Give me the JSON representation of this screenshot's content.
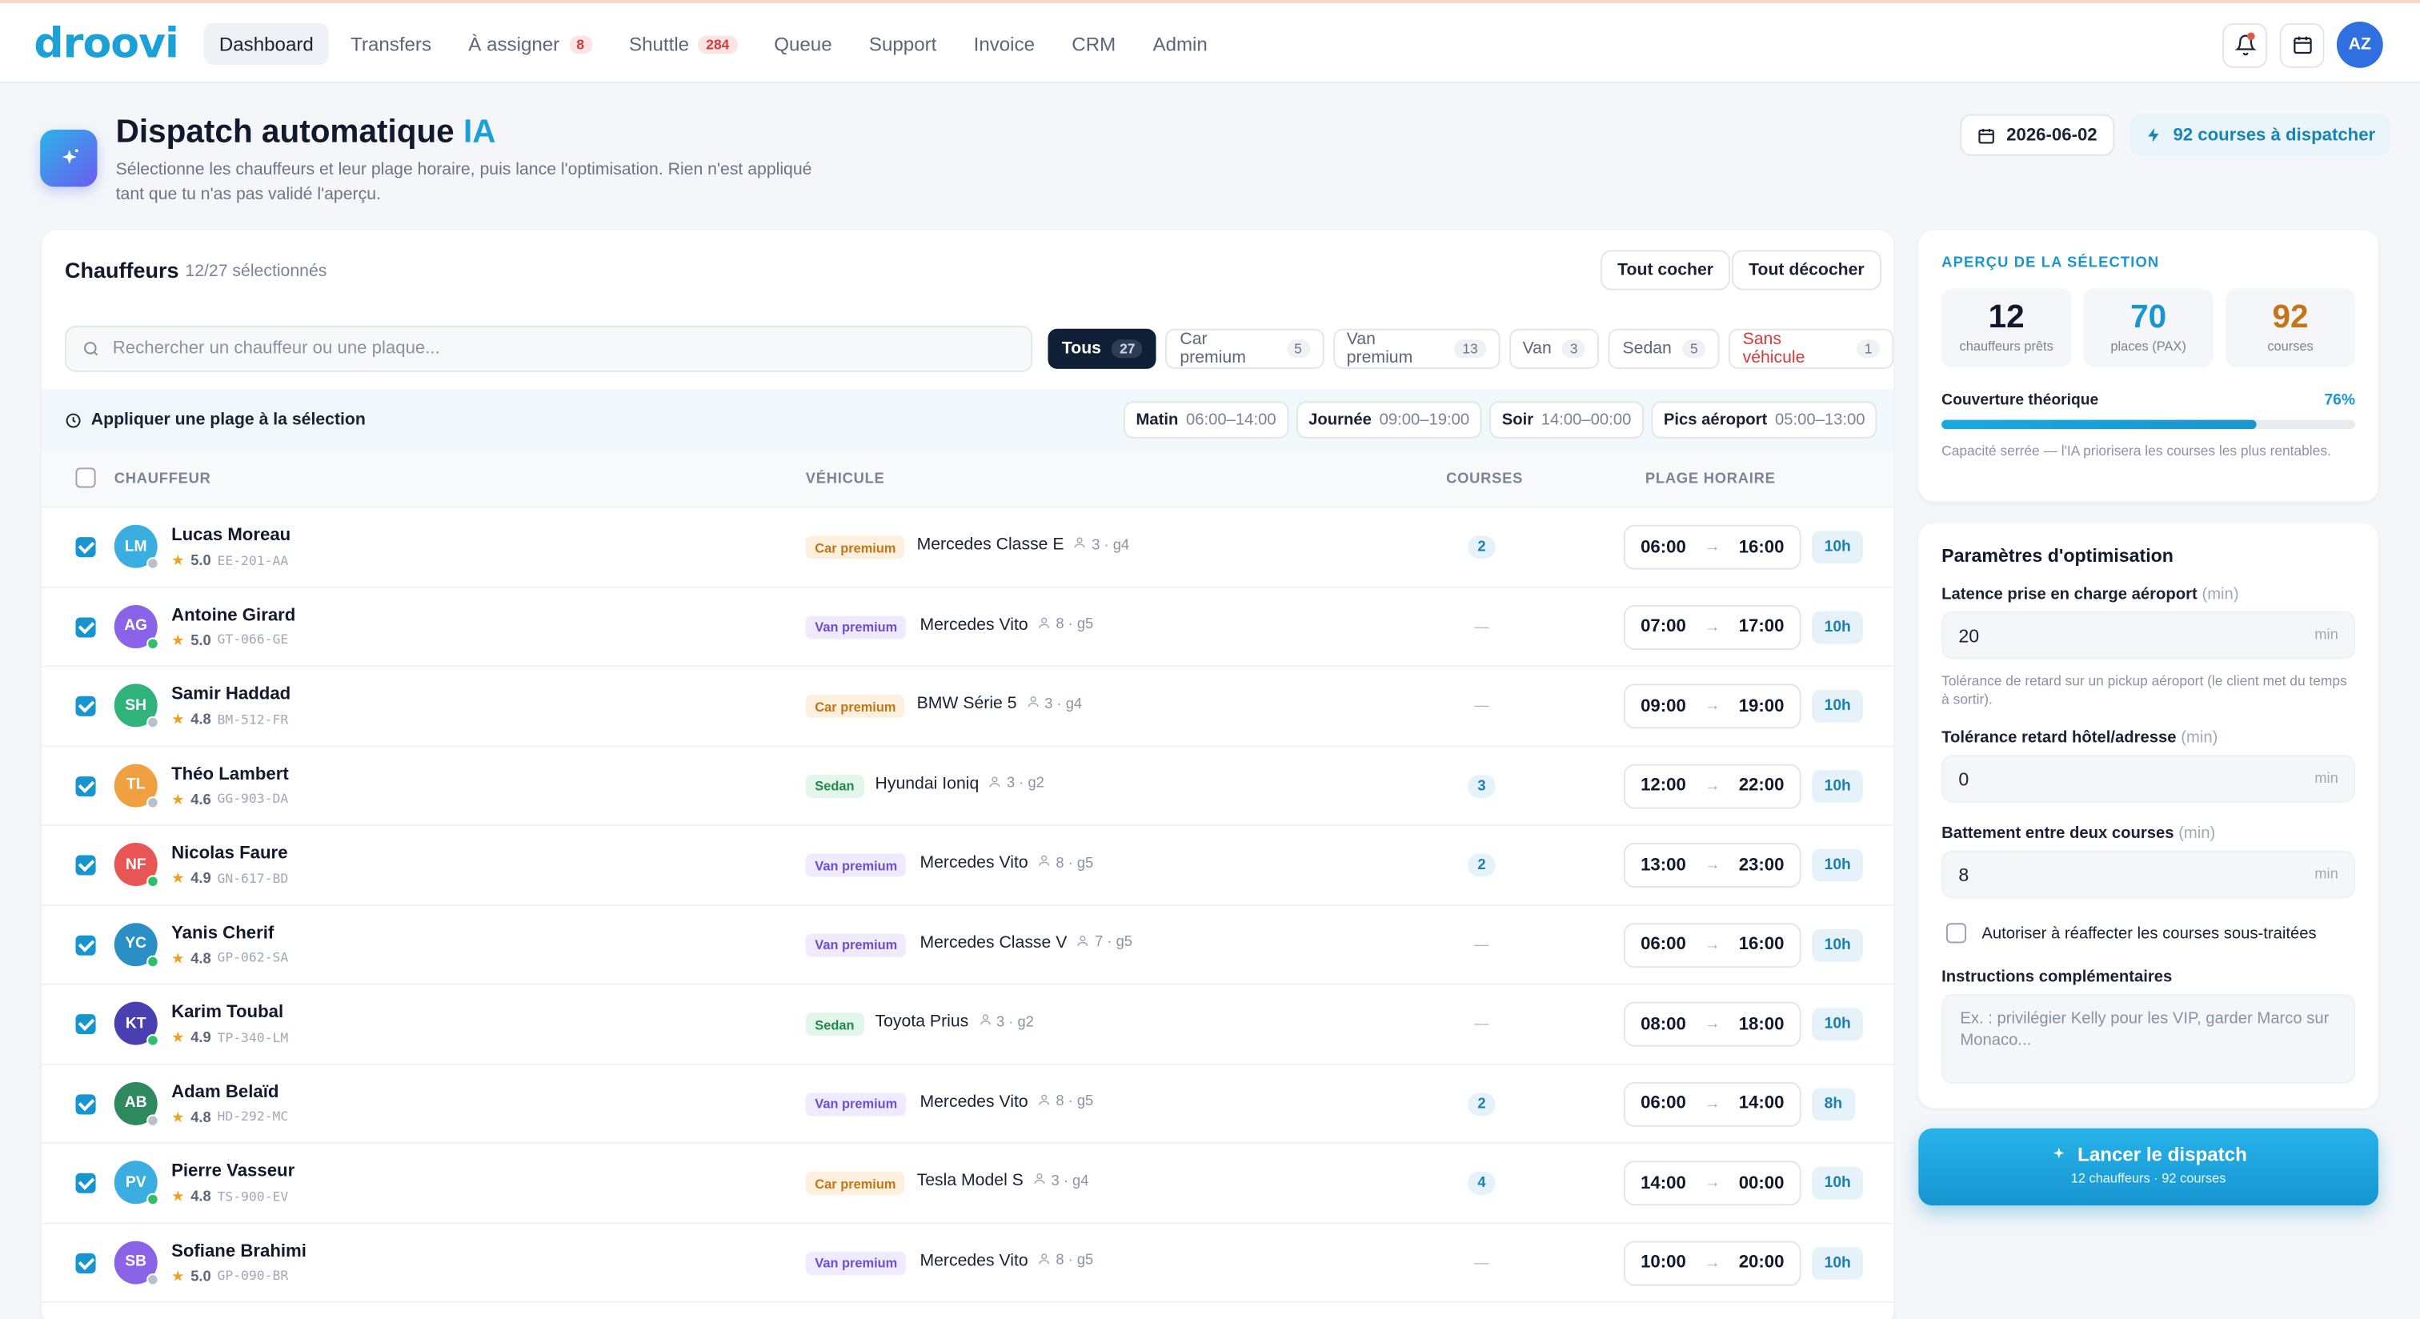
{
  "app": {
    "logo": "droovi"
  },
  "nav": {
    "items": [
      {
        "label": "Dashboard",
        "badge": ""
      },
      {
        "label": "Transfers",
        "badge": ""
      },
      {
        "label": "À assigner",
        "badge": "8"
      },
      {
        "label": "Shuttle",
        "badge": "284"
      },
      {
        "label": "Queue",
        "badge": ""
      },
      {
        "label": "Support",
        "badge": ""
      },
      {
        "label": "Invoice",
        "badge": ""
      },
      {
        "label": "CRM",
        "badge": ""
      },
      {
        "label": "Admin",
        "badge": ""
      }
    ],
    "user_initials": "AZ"
  },
  "header": {
    "title": "Dispatch automatique",
    "title_accent": "IA",
    "subtitle": "Sélectionne les chauffeurs et leur plage horaire, puis lance l'optimisation. Rien n'est appliqué tant que tu n'as pas validé l'aperçu.",
    "date": "2026-06-02",
    "courses_to_dispatch": "92 courses à dispatcher"
  },
  "drivers_panel": {
    "title": "Chauffeurs",
    "selected_count": "12/27 sélectionnés",
    "check_all": "Tout cocher",
    "uncheck_all": "Tout décocher",
    "search_placeholder": "Rechercher un chauffeur ou une plaque...",
    "filters": [
      {
        "label": "Tous",
        "count": "27"
      },
      {
        "label": "Car premium",
        "count": "5"
      },
      {
        "label": "Van premium",
        "count": "13"
      },
      {
        "label": "Van",
        "count": "3"
      },
      {
        "label": "Sedan",
        "count": "5"
      },
      {
        "label": "Sans véhicule",
        "count": "1"
      }
    ],
    "apply_slot_label": "Appliquer une plage à la sélection",
    "slots": [
      {
        "name": "Matin",
        "range": "06:00–14:00"
      },
      {
        "name": "Journée",
        "range": "09:00–19:00"
      },
      {
        "name": "Soir",
        "range": "14:00–00:00"
      },
      {
        "name": "Pics aéroport",
        "range": "05:00–13:00"
      }
    ],
    "columns": {
      "driver": "CHAUFFEUR",
      "vehicle": "VÉHICULE",
      "courses": "COURSES",
      "slot": "PLAGE HORAIRE"
    },
    "rows": [
      {
        "initials": "LM",
        "name": "Lucas Moreau",
        "rating": "5.0",
        "plate": "EE-201-AA",
        "avatar_color": "#3aaee0",
        "status_color": "#b8c0cc",
        "category": "Car premium",
        "cat": "car",
        "vehicle": "Mercedes Classe E",
        "capacity": "3 · g4",
        "courses": "2",
        "start": "06:00",
        "end": "16:00",
        "duration": "10h"
      },
      {
        "initials": "AG",
        "name": "Antoine Girard",
        "rating": "5.0",
        "plate": "GT-066-GE",
        "avatar_color": "#8a63e8",
        "status_color": "#2fbf6a",
        "category": "Van premium",
        "cat": "van",
        "vehicle": "Mercedes Vito",
        "capacity": "8 · g5",
        "courses": "—",
        "start": "07:00",
        "end": "17:00",
        "duration": "10h"
      },
      {
        "initials": "SH",
        "name": "Samir Haddad",
        "rating": "4.8",
        "plate": "BM-512-FR",
        "avatar_color": "#2fb37a",
        "status_color": "#b8c0cc",
        "category": "Car premium",
        "cat": "car",
        "vehicle": "BMW Série 5",
        "capacity": "3 · g4",
        "courses": "—",
        "start": "09:00",
        "end": "19:00",
        "duration": "10h"
      },
      {
        "initials": "TL",
        "name": "Théo Lambert",
        "rating": "4.6",
        "plate": "GG-903-DA",
        "avatar_color": "#f0a040",
        "status_color": "#b8c0cc",
        "category": "Sedan",
        "cat": "sedan",
        "vehicle": "Hyundai Ioniq",
        "capacity": "3 · g2",
        "courses": "3",
        "start": "12:00",
        "end": "22:00",
        "duration": "10h"
      },
      {
        "initials": "NF",
        "name": "Nicolas Faure",
        "rating": "4.9",
        "plate": "GN-617-BD",
        "avatar_color": "#e85555",
        "status_color": "#2fbf6a",
        "category": "Van premium",
        "cat": "van",
        "vehicle": "Mercedes Vito",
        "capacity": "8 · g5",
        "courses": "2",
        "start": "13:00",
        "end": "23:00",
        "duration": "10h"
      },
      {
        "initials": "YC",
        "name": "Yanis Cherif",
        "rating": "4.8",
        "plate": "GP-062-SA",
        "avatar_color": "#2a8fc4",
        "status_color": "#2fbf6a",
        "category": "Van premium",
        "cat": "van",
        "vehicle": "Mercedes Classe V",
        "capacity": "7 · g5",
        "courses": "—",
        "start": "06:00",
        "end": "16:00",
        "duration": "10h"
      },
      {
        "initials": "KT",
        "name": "Karim Toubal",
        "rating": "4.9",
        "plate": "TP-340-LM",
        "avatar_color": "#4a3fb0",
        "status_color": "#2fbf6a",
        "category": "Sedan",
        "cat": "sedan",
        "vehicle": "Toyota Prius",
        "capacity": "3 · g2",
        "courses": "—",
        "start": "08:00",
        "end": "18:00",
        "duration": "10h"
      },
      {
        "initials": "AB",
        "name": "Adam Belaïd",
        "rating": "4.8",
        "plate": "HD-292-MC",
        "avatar_color": "#2e8a5e",
        "status_color": "#b8c0cc",
        "category": "Van premium",
        "cat": "van",
        "vehicle": "Mercedes Vito",
        "capacity": "8 · g5",
        "courses": "2",
        "start": "06:00",
        "end": "14:00",
        "duration": "8h"
      },
      {
        "initials": "PV",
        "name": "Pierre Vasseur",
        "rating": "4.8",
        "plate": "TS-900-EV",
        "avatar_color": "#3aaee0",
        "status_color": "#2fbf6a",
        "category": "Car premium",
        "cat": "car",
        "vehicle": "Tesla Model S",
        "capacity": "3 · g4",
        "courses": "4",
        "start": "14:00",
        "end": "00:00",
        "duration": "10h"
      },
      {
        "initials": "SB",
        "name": "Sofiane Brahimi",
        "rating": "5.0",
        "plate": "GP-090-BR",
        "avatar_color": "#8a63e8",
        "status_color": "#b8c0cc",
        "category": "Van premium",
        "cat": "van",
        "vehicle": "Mercedes Vito",
        "capacity": "8 · g5",
        "courses": "—",
        "start": "10:00",
        "end": "20:00",
        "duration": "10h"
      }
    ]
  },
  "preview": {
    "eyebrow": "APERÇU DE LA SÉLECTION",
    "stats": [
      {
        "value": "12",
        "label": "chauffeurs prêts",
        "color": "#111a2c"
      },
      {
        "value": "70",
        "label": "places (PAX)",
        "color": "#1b95cf"
      },
      {
        "value": "92",
        "label": "courses",
        "color": "#c47515"
      }
    ],
    "coverage_label": "Couverture théorique",
    "coverage_value": "76%",
    "coverage_fraction": 0.76,
    "coverage_note": "Capacité serrée — l'IA priorisera les courses les plus rentables."
  },
  "params": {
    "title": "Paramètres d'optimisation",
    "airport_latency_label": "Latence prise en charge aéroport",
    "airport_latency_unit_label": "(min)",
    "airport_latency_value": "20",
    "unit": "min",
    "airport_latency_help": "Tolérance de retard sur un pickup aéroport (le client met du temps à sortir).",
    "hotel_tolerance_label": "Tolérance retard hôtel/adresse",
    "hotel_tolerance_unit_label": "(min)",
    "hotel_tolerance_value": "0",
    "buffer_label": "Battement entre deux courses",
    "buffer_unit_label": "(min)",
    "buffer_value": "8",
    "reassign_label": "Autoriser à réaffecter les courses sous-traitées",
    "instructions_label": "Instructions complémentaires",
    "instructions_placeholder": "Ex. : privilégier Kelly pour les VIP, garder Marco sur Monaco..."
  },
  "launch": {
    "label": "Lancer le dispatch",
    "sub": "12 chauffeurs · 92 courses"
  }
}
